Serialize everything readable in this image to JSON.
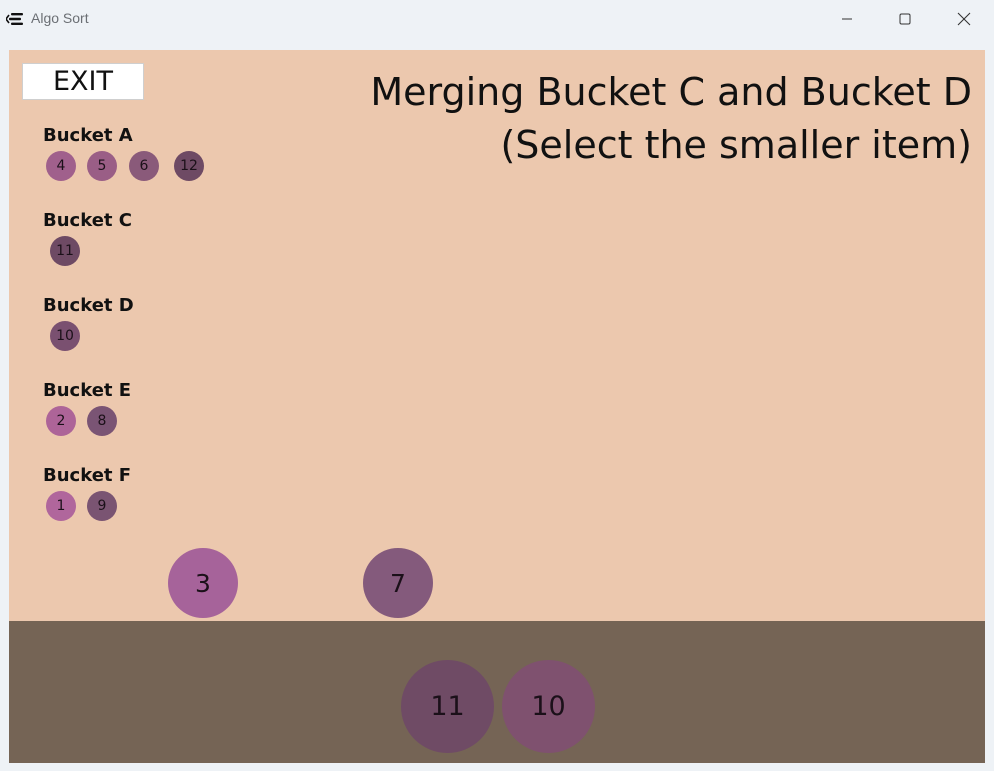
{
  "window": {
    "title": "Algo Sort"
  },
  "game": {
    "exit_label": "EXIT",
    "heading_line1": "Merging Bucket C and Bucket D",
    "heading_line2": "(Select the smaller item)"
  },
  "buckets": [
    {
      "name": "Bucket A",
      "items": [
        "4",
        "5",
        "6",
        "12"
      ],
      "colors": [
        "#a0608c",
        "#9a5e86",
        "#8a5a7a",
        "#6e4a64"
      ]
    },
    {
      "name": "Bucket C",
      "items": [
        "11"
      ],
      "colors": [
        "#6e4a64"
      ]
    },
    {
      "name": "Bucket D",
      "items": [
        "10"
      ],
      "colors": [
        "#7a5070"
      ]
    },
    {
      "name": "Bucket E",
      "items": [
        "2",
        "8"
      ],
      "colors": [
        "#ad6498",
        "#7a5474"
      ]
    },
    {
      "name": "Bucket F",
      "items": [
        "1",
        "9"
      ],
      "colors": [
        "#b0669c",
        "#7a5472"
      ]
    }
  ],
  "floating_items": [
    {
      "value": "3",
      "color": "#a6639a"
    },
    {
      "value": "7",
      "color": "#845a7c"
    }
  ],
  "tray_items": [
    {
      "value": "11",
      "color": "#6f4b65"
    },
    {
      "value": "10",
      "color": "#7f516f"
    }
  ],
  "colors": {
    "play_area": "#ecc8ae",
    "tray": "#756455"
  }
}
